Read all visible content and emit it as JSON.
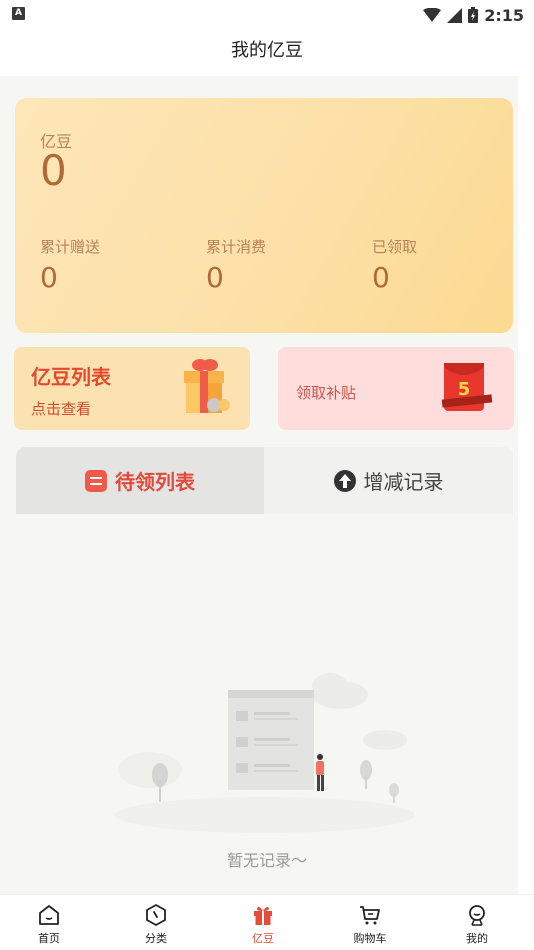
{
  "status_bar": {
    "time": "2:15",
    "notification_glyph": "A"
  },
  "header": {
    "title": "我的亿豆"
  },
  "balance": {
    "label": "亿豆",
    "value": "0",
    "stats": [
      {
        "label": "累计赠送",
        "value": "0"
      },
      {
        "label": "累计消费",
        "value": "0"
      },
      {
        "label": "已领取",
        "value": "0"
      }
    ]
  },
  "cards": {
    "list_title": "亿豆列表",
    "list_subtitle": "点击查看",
    "subsidy_title": "领取补贴",
    "subsidy_badge": "5"
  },
  "tabs": {
    "pending": "待领列表",
    "history": "增减记录"
  },
  "empty": {
    "text": "暂无记录～"
  },
  "nav": [
    {
      "label": "首页",
      "icon": "home-icon"
    },
    {
      "label": "分类",
      "icon": "category-icon"
    },
    {
      "label": "亿豆",
      "icon": "gift-icon",
      "active": true
    },
    {
      "label": "购物车",
      "icon": "cart-icon"
    },
    {
      "label": "我的",
      "icon": "profile-icon"
    }
  ],
  "colors": {
    "accent": "#e84a3a",
    "card_gold": "#fde0a6",
    "card_pink": "#ffdddd"
  }
}
